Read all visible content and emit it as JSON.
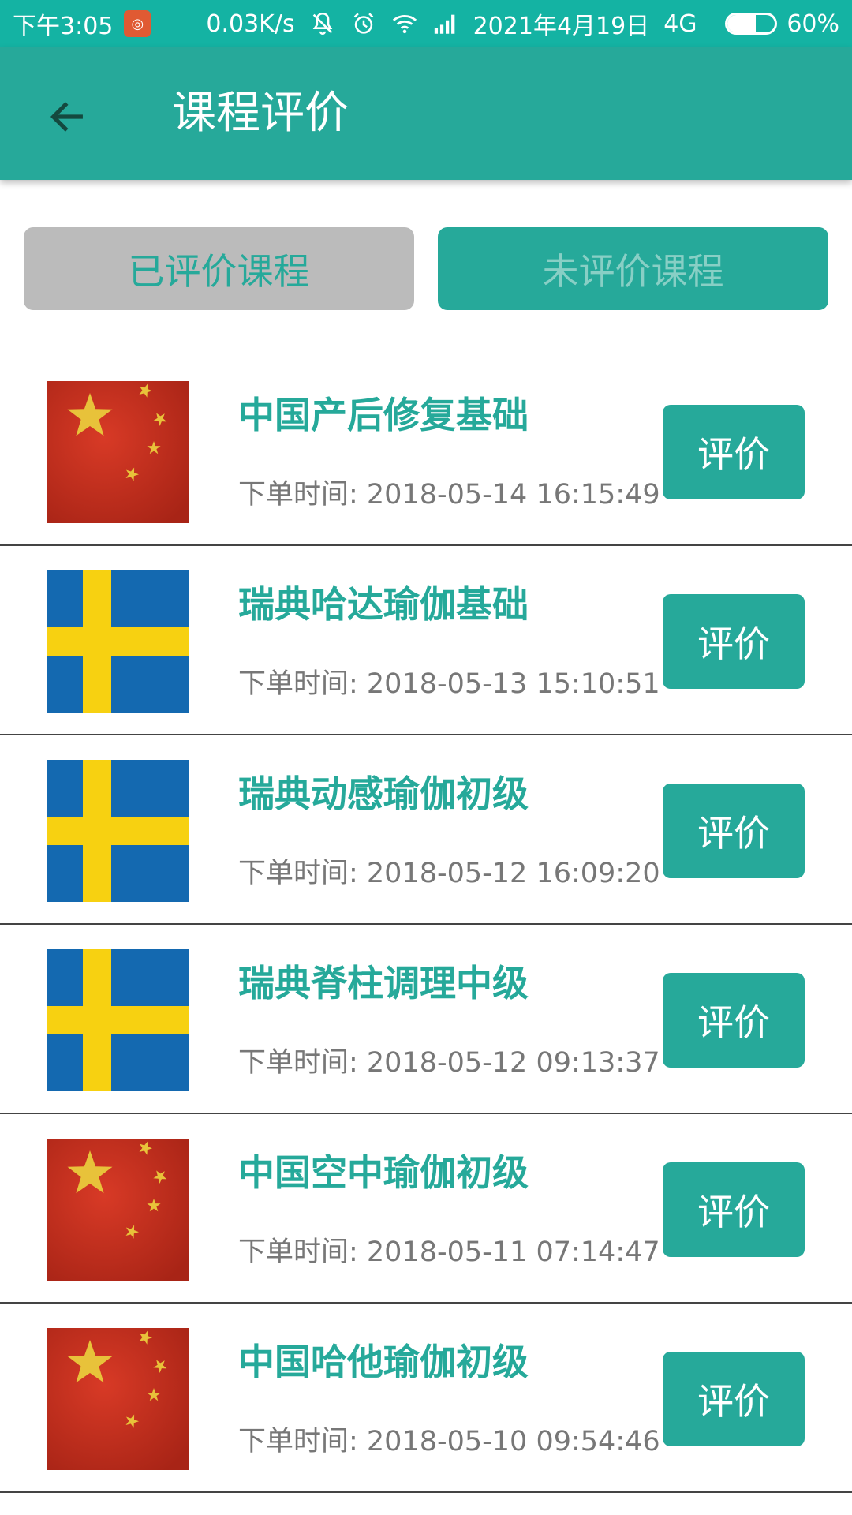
{
  "status_bar": {
    "time": "下午3:05",
    "speed": "0.03K/s",
    "date": "2021年4月19日",
    "network": "4G",
    "battery_percent": "60%",
    "battery_level": 0.6
  },
  "header": {
    "title": "课程评价"
  },
  "tabs": [
    {
      "label": "已评价课程"
    },
    {
      "label": "未评价课程"
    }
  ],
  "colors": {
    "status_bar": "#14b3a3",
    "primary": "#26a99a",
    "tab_inactive": "#bbbbbb",
    "text_secondary": "#777777"
  },
  "order_time_prefix": "下单时间: ",
  "courses": [
    {
      "name": "中国产后修复基础",
      "time_label": "下单时间: 2018-05-14 16:15:49",
      "flag": "china-flag-icon",
      "button": "评价"
    },
    {
      "name": "瑞典哈达瑜伽基础",
      "time_label": "下单时间: 2018-05-13 15:10:51",
      "flag": "sweden-flag-icon",
      "button": "评价"
    },
    {
      "name": "瑞典动感瑜伽初级",
      "time_label": "下单时间: 2018-05-12 16:09:20",
      "flag": "sweden-flag-icon",
      "button": "评价"
    },
    {
      "name": "瑞典脊柱调理中级",
      "time_label": "下单时间: 2018-05-12 09:13:37",
      "flag": "sweden-flag-icon",
      "button": "评价"
    },
    {
      "name": "中国空中瑜伽初级",
      "time_label": "下单时间: 2018-05-11 07:14:47",
      "flag": "china-flag-icon",
      "button": "评价"
    },
    {
      "name": "中国哈他瑜伽初级",
      "time_label": "下单时间: 2018-05-10 09:54:46",
      "flag": "china-flag-icon",
      "button": "评价"
    }
  ]
}
